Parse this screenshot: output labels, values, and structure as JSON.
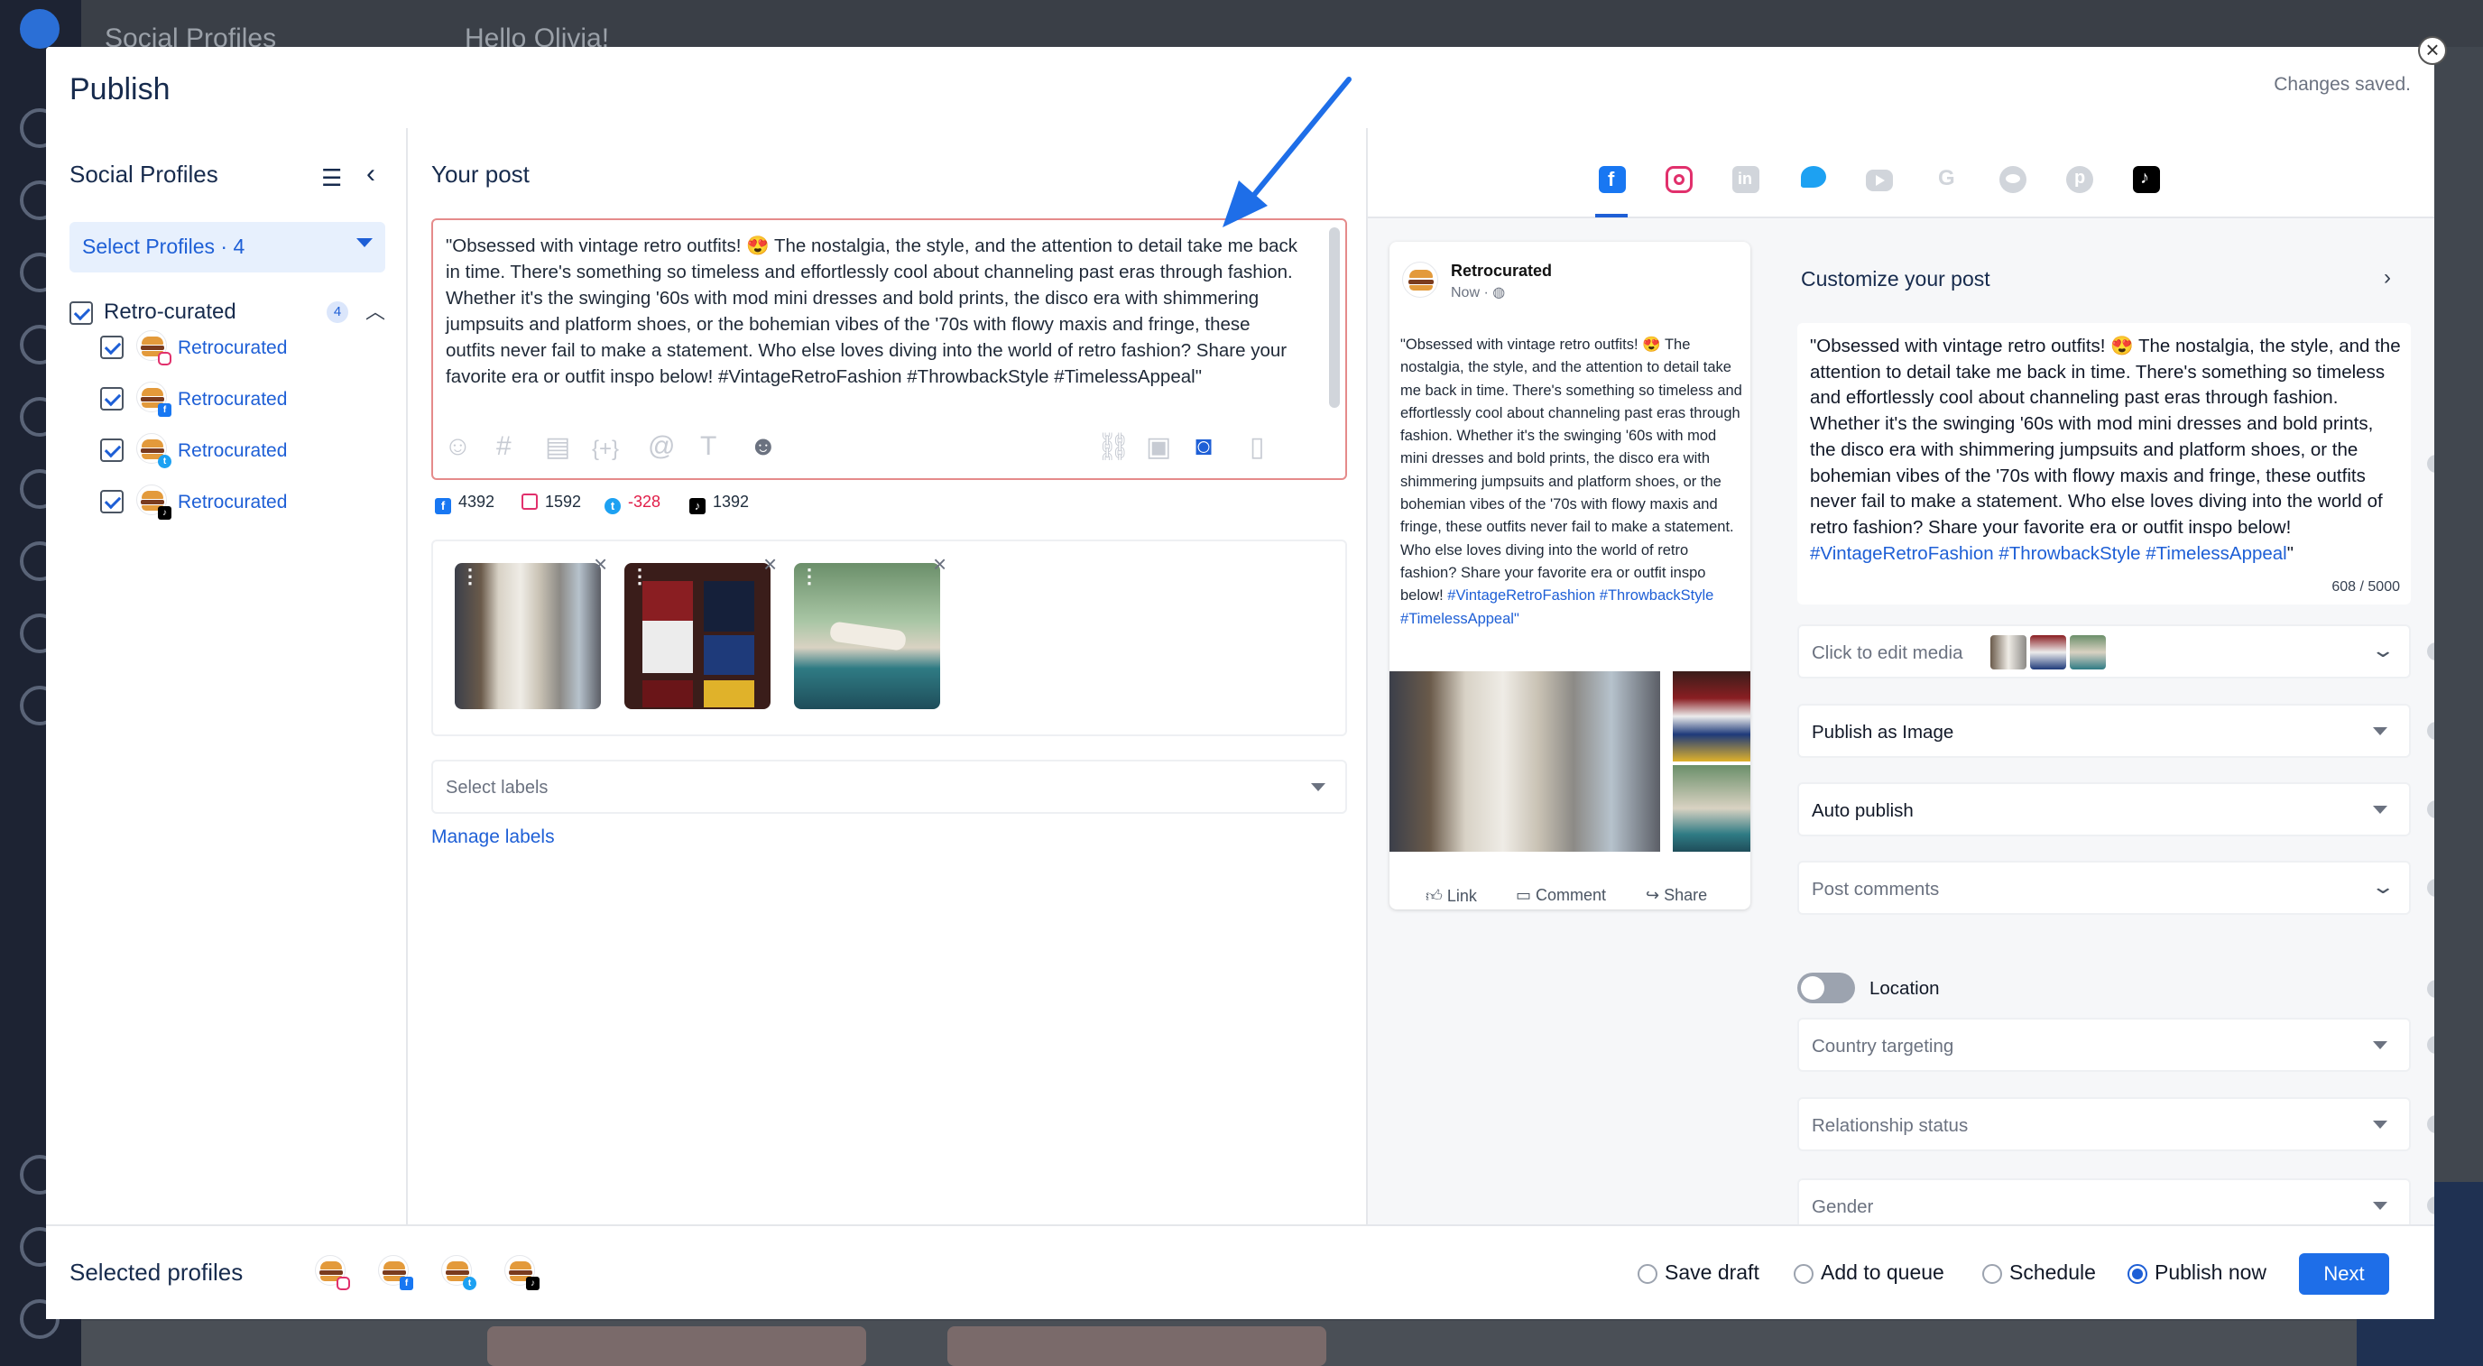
{
  "background": {
    "top_title": "Social Profiles",
    "greeting": "Hello Olivia!"
  },
  "modal": {
    "title": "Publish",
    "status": "Changes saved.",
    "close_icon": "close-icon"
  },
  "sidebar": {
    "title": "Social Profiles",
    "select_label": "Select Profiles · 4",
    "group": {
      "label": "Retro-curated",
      "count": "4"
    },
    "profiles": [
      {
        "label": "Retrocurated",
        "network": "instagram"
      },
      {
        "label": "Retrocurated",
        "network": "facebook"
      },
      {
        "label": "Retrocurated",
        "network": "twitter"
      },
      {
        "label": "Retrocurated",
        "network": "tiktok"
      }
    ]
  },
  "post": {
    "title": "Your post",
    "text": "\"Obsessed with vintage retro outfits! 😍 The nostalgia, the style, and the attention to detail take me back in time. There's something so timeless and effortlessly cool about channeling past eras through fashion. Whether it's the swinging '60s with mod mini dresses and bold prints, the disco era with shimmering jumpsuits and platform shoes, or the bohemian vibes of the '70s with flowy maxis and fringe, these outfits never fail to make a statement. Who else loves diving into the world of retro fashion? Share your favorite era or outfit inspo below! #VintageRetroFashion #ThrowbackStyle #TimelessAppeal\"",
    "counts": {
      "facebook": "4392",
      "instagram": "1592",
      "twitter": "-328",
      "tiktok": "1392"
    },
    "labels_placeholder": "Select labels",
    "manage_labels": "Manage labels"
  },
  "preview": {
    "profile_name": "Retrocurated",
    "time": "Now · ◍",
    "text_body": "\"Obsessed with vintage retro outfits! 😍 The nostalgia, the style, and the attention to detail take me back in time. There's something so timeless and effortlessly cool about channeling past eras through fashion. Whether it's the swinging '60s with mod mini dresses and bold prints, the disco era with shimmering jumpsuits and platform shoes, or the bohemian vibes of the '70s with flowy maxis and fringe, these outfits never fail to make a statement. Who else loves diving into the world of retro fashion? Share your favorite era or outfit inspo below!",
    "text_hashtags": "#VintageRetroFashion #ThrowbackStyle #TimelessAppeal\"",
    "actions": {
      "like": "Link",
      "comment": "Comment",
      "share": "Share"
    }
  },
  "customize": {
    "title": "Customize your post",
    "text_body": "\"Obsessed with vintage retro outfits! 😍 The nostalgia, the style, and the attention to detail take me back in time. There's something so timeless and effortlessly cool about channeling past eras through fashion. Whether it's the swinging '60s with mod mini dresses and bold prints, the disco era with shimmering jumpsuits and platform shoes, or the bohemian vibes of the '70s with flowy maxis and fringe, these outfits never fail to make a statement. Who else loves diving into the world of retro fashion? Share your favorite era or outfit inspo below!",
    "text_hashtags": "#VintageRetroFashion #ThrowbackStyle #TimelessAppeal",
    "text_tail": "\"",
    "char_count": "608 / 5000",
    "edit_media": "Click to edit media",
    "publish_as": "Publish as Image",
    "auto_publish": "Auto publish",
    "post_comments": "Post comments",
    "location": "Location",
    "country_targeting": "Country targeting",
    "relationship_status": "Relationship status",
    "gender": "Gender"
  },
  "footer": {
    "title": "Selected profiles",
    "options": {
      "save_draft": "Save draft",
      "add_to_queue": "Add to queue",
      "schedule": "Schedule",
      "publish_now": "Publish now"
    },
    "selected_option": "publish_now",
    "next": "Next"
  },
  "colors": {
    "accent": "#1e5fd6",
    "facebook": "#1877f2",
    "instagram": "#e1306c",
    "twitter": "#1da1f2",
    "tiktok": "#000000",
    "over_limit": "#e11d48"
  },
  "network_tabs": [
    "facebook-icon",
    "instagram-icon",
    "linkedin-icon",
    "twitter-icon",
    "youtube-icon",
    "google-icon",
    "reddit-icon",
    "pinterest-icon",
    "tiktok-icon"
  ]
}
